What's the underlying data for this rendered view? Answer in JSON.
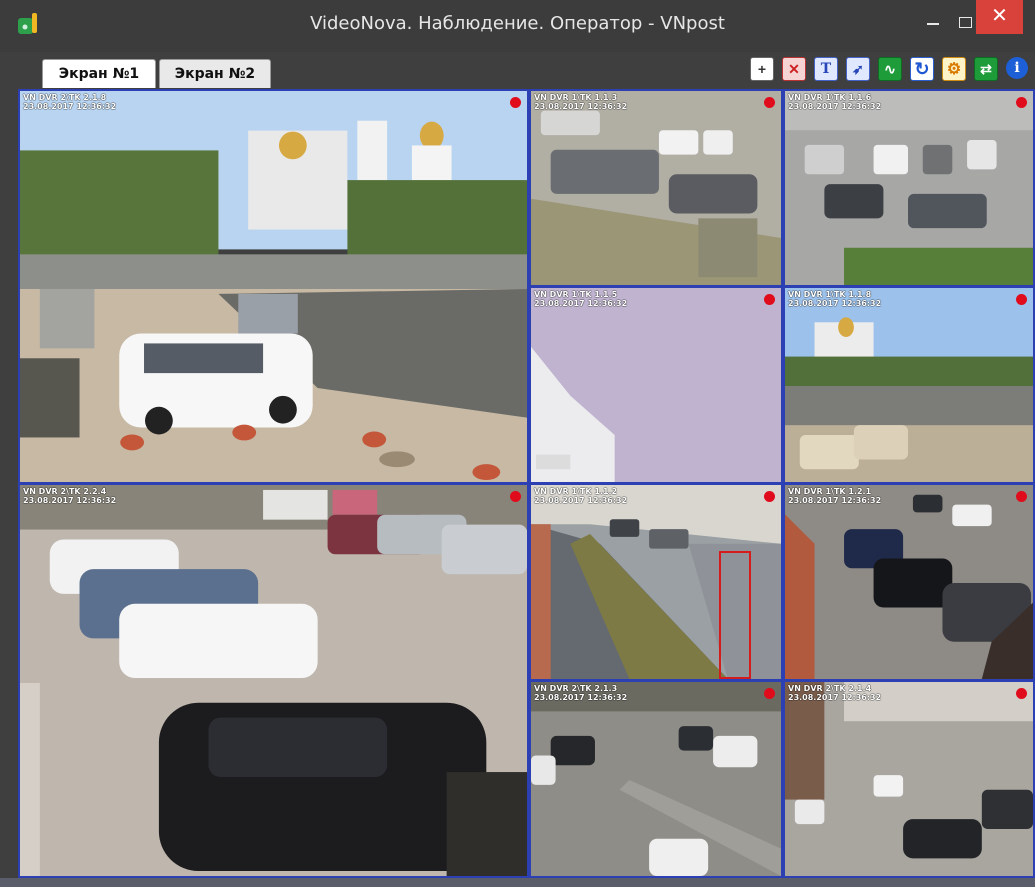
{
  "window": {
    "title": "VideoNova. Наблюдение. Оператор - VNpost",
    "close_glyph": "✕"
  },
  "tabs": [
    {
      "label": "Экран №1",
      "active": true
    },
    {
      "label": "Экран №2",
      "active": false
    }
  ],
  "toolbar": [
    {
      "icon": "add-icon",
      "glyph": "+"
    },
    {
      "icon": "grid-delete-icon",
      "glyph": "✕"
    },
    {
      "icon": "text-icon",
      "glyph": "T"
    },
    {
      "icon": "camera-icon",
      "glyph": "➶"
    },
    {
      "icon": "activity-icon",
      "glyph": "∿"
    },
    {
      "icon": "refresh-icon",
      "glyph": "↻"
    },
    {
      "icon": "settings-icon",
      "glyph": "⚙"
    },
    {
      "icon": "switch-icon",
      "glyph": "⇄"
    },
    {
      "icon": "info-icon",
      "glyph": "i"
    }
  ],
  "cameras": [
    {
      "name": "VN DVR 2\\TK 2.1.8",
      "timestamp": "23.08.2017 12:36:32",
      "recording": true
    },
    {
      "name": "VN DVR 1\\TK 1.1.3",
      "timestamp": "23.08.2017 12:36:32",
      "recording": true
    },
    {
      "name": "VN DVR 1\\TK 1.1.6",
      "timestamp": "23.08.2017 12:36:32",
      "recording": true
    },
    {
      "name": "VN DVR 1\\TK 1.1.5",
      "timestamp": "23.08.2017 12:36:32",
      "recording": true
    },
    {
      "name": "VN DVR 1\\TK 1.1.8",
      "timestamp": "23.08.2017 12:36:32",
      "recording": true
    },
    {
      "name": "VN DVR 2\\TK 2.2.4",
      "timestamp": "23.08.2017 12:36:32",
      "recording": true
    },
    {
      "name": "VN DVR 1\\TK 1.1.2",
      "timestamp": "23.08.2017 12:36:32",
      "recording": true
    },
    {
      "name": "VN DVR 1\\TK 1.2.1",
      "timestamp": "23.08.2017 12:36:32",
      "recording": true
    },
    {
      "name": "VN DVR 2\\TK 2.1.3",
      "timestamp": "23.08.2017 12:36:32",
      "recording": true
    },
    {
      "name": "VN DVR 2\\TK 2.1.4",
      "timestamp": "23.08.2017 12:36:32",
      "recording": true
    }
  ],
  "colors": {
    "recording": "#e00c1b",
    "tile_border": "#2c3fb3",
    "detection": "#d41c1c"
  }
}
